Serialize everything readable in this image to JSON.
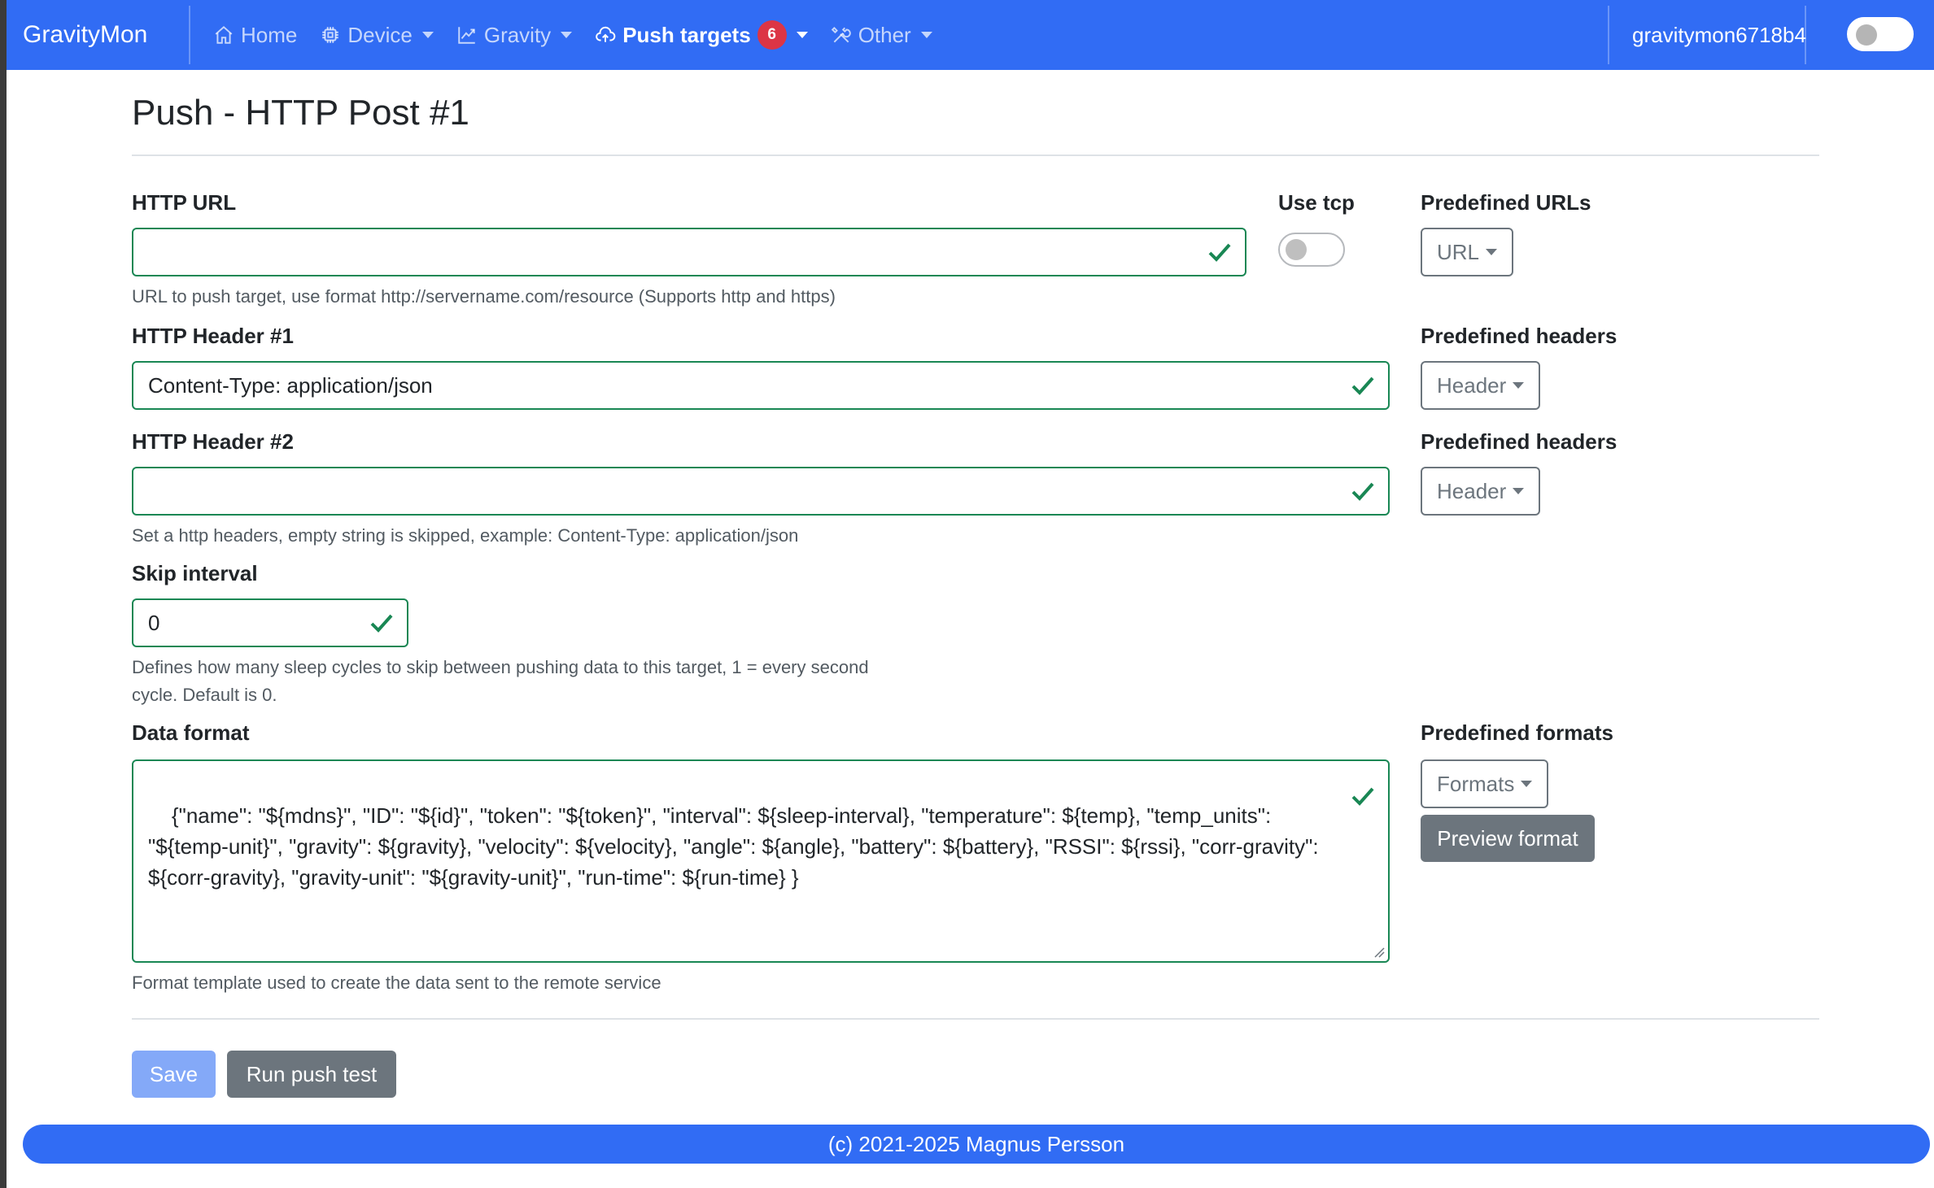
{
  "navbar": {
    "brand": "GravityMon",
    "items": [
      {
        "label": "Home",
        "icon": "home-icon"
      },
      {
        "label": "Device",
        "icon": "chip-icon"
      },
      {
        "label": "Gravity",
        "icon": "graph-icon"
      },
      {
        "label": "Push targets",
        "icon": "cloud-upload-icon",
        "badge": "6"
      },
      {
        "label": "Other",
        "icon": "tools-icon"
      }
    ],
    "hostname": "gravitymon6718b4",
    "dark_mode_toggle": "off"
  },
  "page": {
    "title": "Push - HTTP Post #1"
  },
  "form": {
    "http_url": {
      "label": "HTTP URL",
      "value": "",
      "help": "URL to push target, use format http://servername.com/resource (Supports http and https)"
    },
    "use_tcp": {
      "label": "Use tcp",
      "state": "off"
    },
    "predefined_urls": {
      "label": "Predefined URLs",
      "button": "URL"
    },
    "header1": {
      "label": "HTTP Header #1",
      "value": "Content-Type: application/json"
    },
    "predefined_headers1": {
      "label": "Predefined headers",
      "button": "Header"
    },
    "header2": {
      "label": "HTTP Header #2",
      "value": "",
      "help": "Set a http headers, empty string is skipped, example: Content-Type: application/json"
    },
    "predefined_headers2": {
      "label": "Predefined headers",
      "button": "Header"
    },
    "skip_interval": {
      "label": "Skip interval",
      "value": "0",
      "help_line1": "Defines how many sleep cycles to skip between pushing data to this target, 1 = every second",
      "help_line2": "cycle. Default is 0."
    },
    "data_format": {
      "label": "Data format",
      "value": "{\"name\": \"${mdns}\", \"ID\": \"${id}\", \"token\": \"${token}\", \"interval\": ${sleep-interval}, \"temperature\": ${temp}, \"temp_units\": \"${temp-unit}\", \"gravity\": ${gravity}, \"velocity\": ${velocity}, \"angle\": ${angle}, \"battery\": ${battery}, \"RSSI\": ${rssi}, \"corr-gravity\": ${corr-gravity}, \"gravity-unit\": \"${gravity-unit}\", \"run-time\": ${run-time} }",
      "help": "Format template used to create the data sent to the remote service"
    },
    "predefined_formats": {
      "label": "Predefined formats",
      "button": "Formats",
      "preview": "Preview format"
    }
  },
  "actions": {
    "save": "Save",
    "run_test": "Run push test"
  },
  "footer": {
    "text": "(c) 2021-2025 Magnus Persson"
  },
  "colors": {
    "navbar": "#316cf4",
    "valid": "#198754",
    "secondary": "#6c757d",
    "badge": "#dc3545"
  }
}
